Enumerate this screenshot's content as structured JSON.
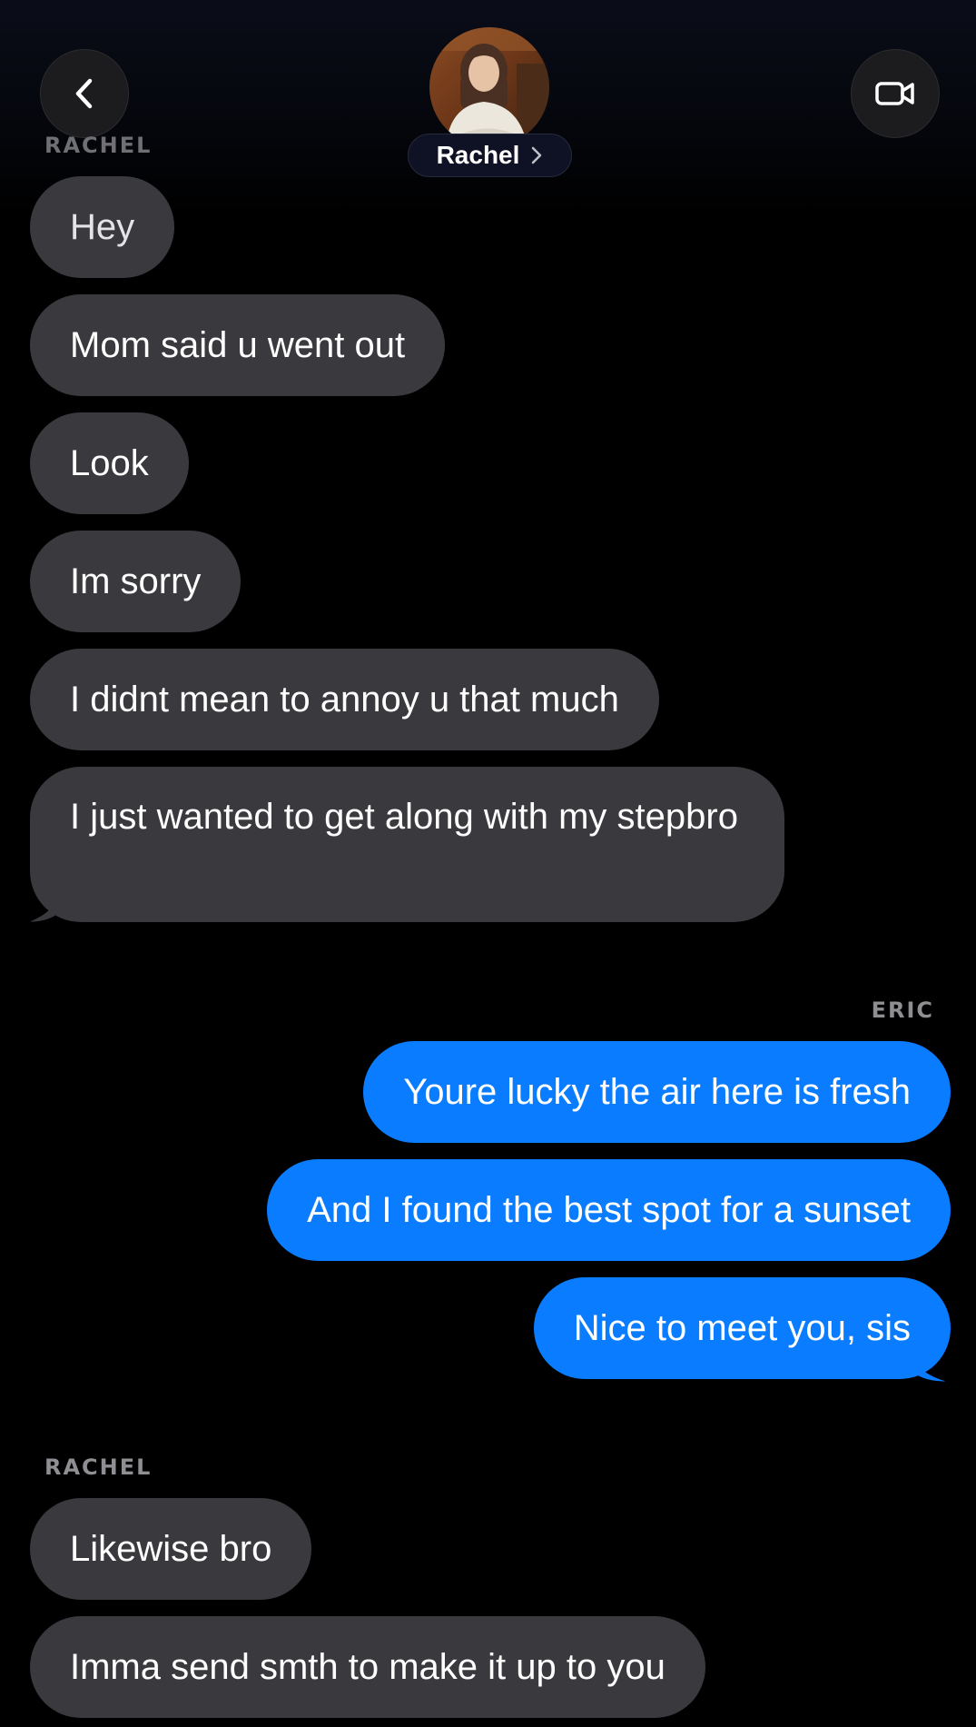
{
  "header": {
    "contact_name": "Rachel",
    "back_icon": "chevron-left-icon",
    "video_icon": "video-camera-icon",
    "name_chevron_icon": "chevron-right-icon"
  },
  "colors": {
    "incoming_bubble": "#3a3a3e",
    "outgoing_bubble": "#0a7cff",
    "background": "#000000",
    "sender_label": "#8e8e93"
  },
  "conversation": {
    "group1": {
      "sender": "RACHEL",
      "messages": [
        "Hey",
        "Mom said u went out",
        "Look",
        "Im sorry",
        "I didnt mean to annoy u that much",
        "I just wanted to get along with my stepbro"
      ]
    },
    "group2": {
      "sender": "ERIC",
      "messages": [
        "Youre lucky the air here is fresh",
        "And I found the best spot for a sunset",
        "Nice to meet you, sis"
      ]
    },
    "group3": {
      "sender": "RACHEL",
      "messages": [
        "Likewise bro",
        "Imma send smth to make it up to you"
      ]
    }
  }
}
